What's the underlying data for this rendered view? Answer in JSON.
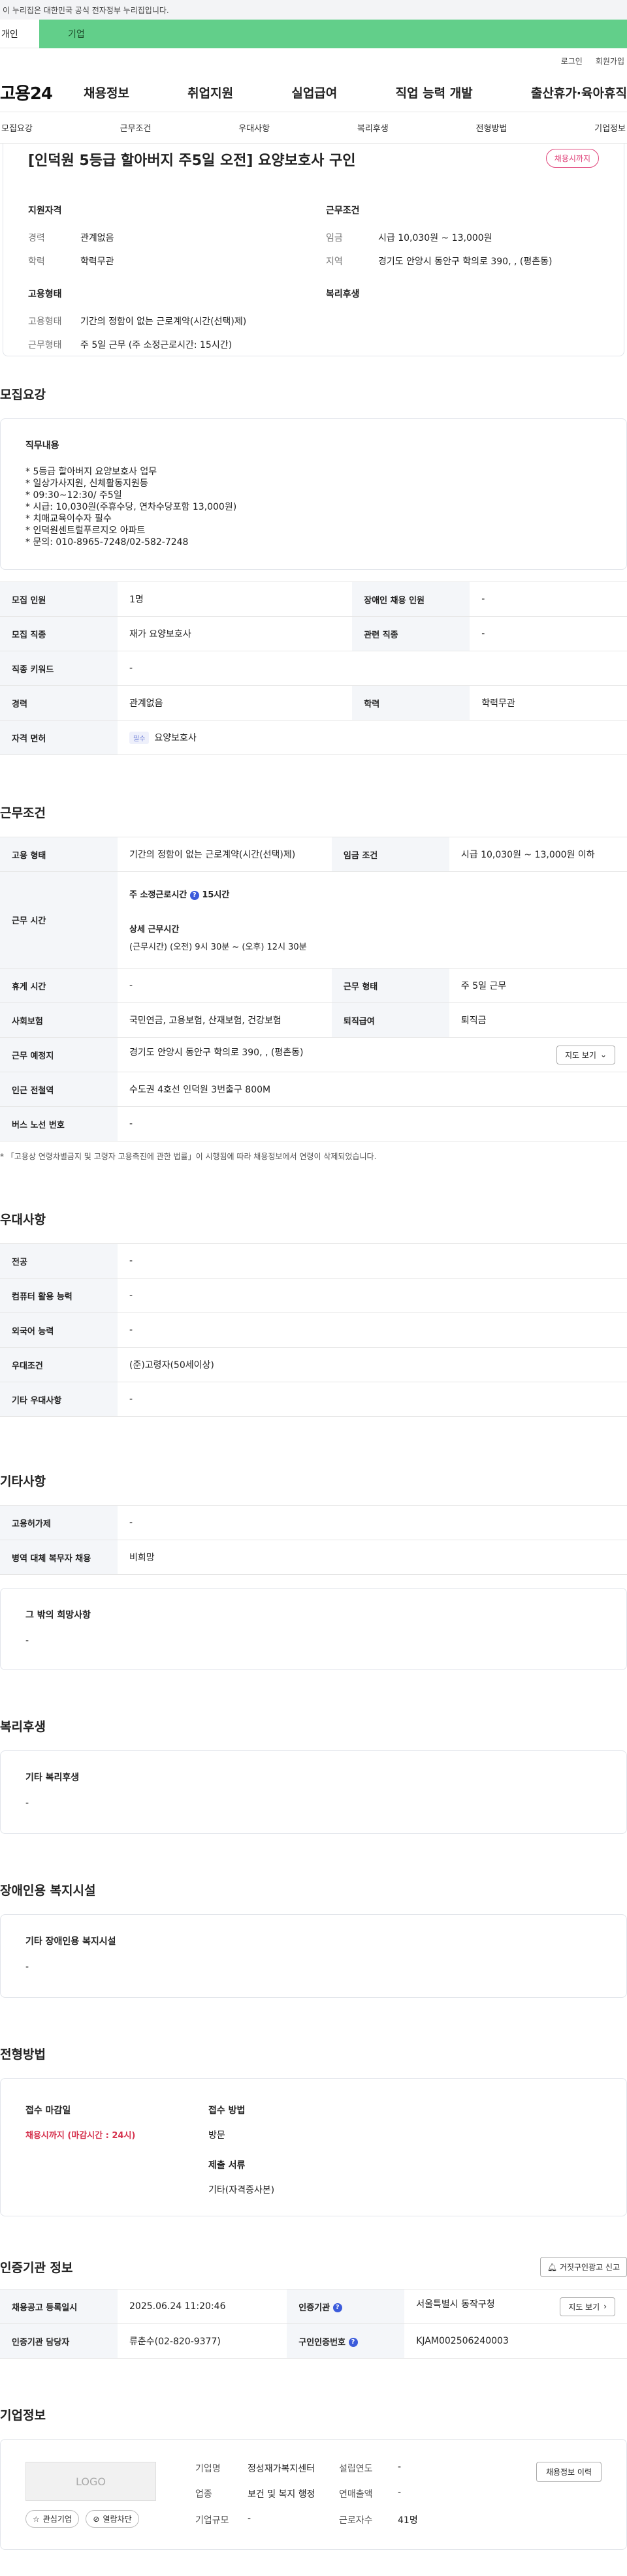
{
  "gov_banner": "이 누리집은 대한민국 공식 전자정부 누리집입니다.",
  "tabs": {
    "individual": "개인",
    "company": "기업"
  },
  "util": {
    "login": "로그인",
    "join": "회원가입"
  },
  "logo": "고용24",
  "gnb": [
    "채용정보",
    "취업지원",
    "실업급여",
    "직업 능력 개발",
    "출산휴가·육아휴직"
  ],
  "anchor_tabs": [
    "모집요강",
    "근무조건",
    "우대사항",
    "복리후생",
    "전형방법",
    "기업정보"
  ],
  "summary": {
    "title": "[인덕원 5등급 할아버지 주5일 오전] 요양보호사 구인",
    "deadline_badge": "채용시까지",
    "qual": {
      "heading": "지원자격",
      "rows": [
        {
          "k": "경력",
          "v": "관계없음"
        },
        {
          "k": "학력",
          "v": "학력무관"
        }
      ]
    },
    "cond": {
      "heading": "근무조건",
      "rows": [
        {
          "k": "임금",
          "v": "시급 10,030원 ~ 13,000원"
        },
        {
          "k": "지역",
          "v": "경기도 안양시 동안구 학의로 390, , (평촌동)"
        }
      ]
    },
    "emp": {
      "heading": "고용형태",
      "rows": [
        {
          "k": "고용형태",
          "v": "기간의 정함이 없는 근로계약(시간(선택)제)"
        },
        {
          "k": "근무형태",
          "v": "주 5일 근무 (주 소정근로시간: 15시간)"
        }
      ]
    },
    "welfare": {
      "heading": "복리후생"
    }
  },
  "recruit": {
    "title": "모집요강",
    "job_heading": "직무내용",
    "job_lines": [
      "* 5등급 할아버지 요양보호사 업무",
      "* 일상가사지원, 신체활동지원등",
      "* 09:30~12:30/ 주5일",
      "* 시급: 10,030원(주휴수당, 연차수당포함 13,000원)",
      "* 치매교육이수자 필수",
      "* 인덕원센트럴푸르지오 아파트",
      "* 문의: 010-8965-7248/02-582-7248"
    ],
    "table": {
      "headcount_k": "모집 인원",
      "headcount_v": "1명",
      "disabled_k": "장애인 채용 인원",
      "disabled_v": "-",
      "job_k": "모집 직종",
      "job_v": "재가 요양보호사",
      "rel_k": "관련 직종",
      "rel_v": "-",
      "kw_k": "직종 키워드",
      "kw_v": "-",
      "career_k": "경력",
      "career_v": "관계없음",
      "edu_k": "학력",
      "edu_v": "학력무관",
      "license_k": "자격 면허",
      "license_badge": "필수",
      "license_v": "요양보호사"
    }
  },
  "work": {
    "title": "근무조건",
    "type_k": "고용 형태",
    "type_v": "기간의 정함이 없는 근로계약(시간(선택)제)",
    "wage_k": "임금 조건",
    "wage_v": "시급 10,030원 ~ 13,000원 이하",
    "hours_k": "근무 시간",
    "hours_weekly_label": "주 소정근로시간",
    "hours_weekly_v": "15시간",
    "hours_detail_label": "상세 근무시간",
    "hours_detail_v": "(근무시간) (오전) 9시 30분 ~ (오후) 12시 30분",
    "break_k": "휴게 시간",
    "break_v": "-",
    "form_k": "근무 형태",
    "form_v": "주 5일 근무",
    "ins_k": "사회보험",
    "ins_v": "국민연금, 고용보험, 산재보험, 건강보험",
    "retire_k": "퇴직급여",
    "retire_v": "퇴직금",
    "loc_k": "근무 예정지",
    "loc_v": "경기도 안양시 동안구 학의로 390, , (평촌동)",
    "map_btn": "지도 보기",
    "station_k": "인근 전철역",
    "station_v": "수도권 4호선 인덕원 3번출구 800M",
    "bus_k": "버스 노선 번호",
    "bus_v": "-",
    "note": "* 「고용상 연령차별금지 및 고령자 고용촉진에 관한 법률」이 시행됨에 따라 채용정보에서 연령이 삭제되었습니다."
  },
  "pref": {
    "title": "우대사항",
    "rows": [
      {
        "k": "전공",
        "v": "-"
      },
      {
        "k": "컴퓨터 활용 능력",
        "v": "-"
      },
      {
        "k": "외국어 능력",
        "v": "-"
      },
      {
        "k": "우대조건",
        "v": "(준)고령자(50세이상)"
      },
      {
        "k": "기타 우대사항",
        "v": "-"
      }
    ]
  },
  "etc": {
    "title": "기타사항",
    "rows": [
      {
        "k": "고용허가제",
        "v": "-"
      },
      {
        "k": "병역 대체 복무자 채용",
        "v": "비희망"
      }
    ],
    "other_heading": "그 밖의 희망사항",
    "other_v": "-"
  },
  "welfare": {
    "title": "복리후생",
    "heading": "기타 복리후생",
    "v": "-"
  },
  "disabled": {
    "title": "장애인용 복지시설",
    "heading": "기타 장애인용 복지시설",
    "v": "-"
  },
  "apply": {
    "title": "전형방법",
    "deadline_heading": "접수 마감일",
    "deadline_v": "채용시까지 (마감시간 : 24시)",
    "method_heading": "접수 방법",
    "method_v": "방문",
    "docs_heading": "제출 서류",
    "docs_v": "기타(자격증사본)"
  },
  "cert": {
    "title": "인증기관 정보",
    "report_btn": "거짓구인광고 신고",
    "date_k": "채용공고 등록일시",
    "date_v": "2025.06.24 11:20:46",
    "org_k": "인증기관",
    "org_v": "서울특별시 동작구청",
    "map_btn": "지도 보기",
    "mgr_k": "인증기관 담당자",
    "mgr_v": "류춘수(02-820-9377)",
    "no_k": "구인인증번호",
    "no_v": "KJAM002506240003"
  },
  "company": {
    "title": "기업정보",
    "logo_text": "LOGO",
    "fav": "관심기업",
    "block": "열람차단",
    "name_k": "기업명",
    "name_v": "정성재가복지센터",
    "est_k": "설립연도",
    "est_v": "-",
    "ind_k": "업종",
    "ind_v": "보건 및 복지 행정",
    "sales_k": "연매출액",
    "sales_v": "-",
    "size_k": "기업규모",
    "size_v": "-",
    "emp_k": "근로자수",
    "emp_v": "41명",
    "history_btn": "채용정보 이력"
  }
}
